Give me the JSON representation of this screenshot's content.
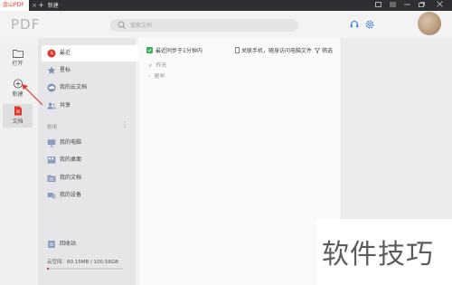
{
  "titlebar": {
    "active_tab": "金山PDF",
    "tab_close": "×",
    "new_tab": "新建",
    "new_tab_icon": "plus-icon"
  },
  "header": {
    "logo": "PDF",
    "search_placeholder": "搜索文档",
    "icons": [
      "headset-icon",
      "gear-icon"
    ]
  },
  "rail": {
    "items": [
      {
        "label": "打开",
        "icon": "folder-icon"
      },
      {
        "label": "新建",
        "icon": "plus-circle-icon"
      },
      {
        "label": "文档",
        "icon": "document-icon",
        "active": true
      }
    ]
  },
  "sidebar": {
    "items": [
      {
        "label": "最近",
        "icon": "clock-icon",
        "active": true
      },
      {
        "label": "星标",
        "icon": "star-icon"
      },
      {
        "label": "我的云文档",
        "icon": "cloud-icon"
      },
      {
        "label": "共享",
        "icon": "share-users-icon"
      }
    ],
    "section_label": "常用",
    "section_more": "⋮",
    "common": [
      {
        "label": "我的电脑",
        "icon": "computer-icon"
      },
      {
        "label": "我的桌面",
        "icon": "desktop-icon"
      },
      {
        "label": "我的文档",
        "icon": "folder-doc-icon"
      },
      {
        "label": "我的设备",
        "icon": "device-icon"
      }
    ],
    "trash": "回收站",
    "storage_label": "云空间：60.15MB / 100.56GB",
    "storage_used_fraction": 0.0006
  },
  "main": {
    "sync_text": "最近同步于1分钟内",
    "phone_link": "关联手机，随身访问电脑文件",
    "filter": "筛选",
    "groups": [
      "昨天",
      "更早"
    ]
  },
  "watermark": "软件技巧",
  "colors": {
    "accent": "#e0352b",
    "sidebar_bg": "#e6e6e8"
  }
}
